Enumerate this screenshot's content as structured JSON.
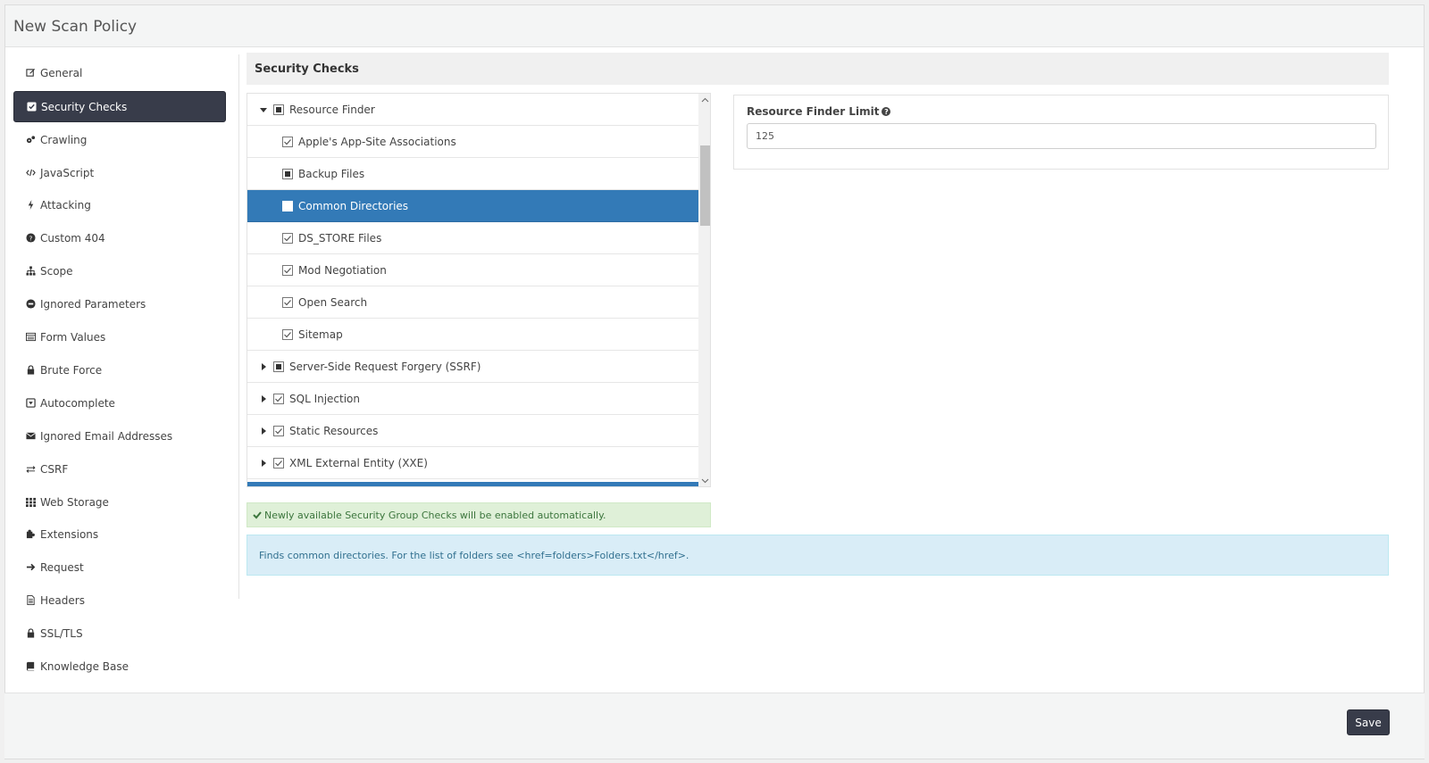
{
  "window": {
    "title": "New Scan Policy"
  },
  "sidebar": {
    "items": [
      {
        "label": "General",
        "icon": "edit-icon"
      },
      {
        "label": "Security Checks",
        "icon": "check-square-icon",
        "active": true
      },
      {
        "label": "Crawling",
        "icon": "gears-icon"
      },
      {
        "label": "JavaScript",
        "icon": "code-icon"
      },
      {
        "label": "Attacking",
        "icon": "bolt-icon"
      },
      {
        "label": "Custom 404",
        "icon": "question-circle-icon"
      },
      {
        "label": "Scope",
        "icon": "sitemap-icon"
      },
      {
        "label": "Ignored Parameters",
        "icon": "minus-circle-icon"
      },
      {
        "label": "Form Values",
        "icon": "form-icon"
      },
      {
        "label": "Brute Force",
        "icon": "lock-icon"
      },
      {
        "label": "Autocomplete",
        "icon": "caret-square-icon"
      },
      {
        "label": "Ignored Email Addresses",
        "icon": "envelope-icon"
      },
      {
        "label": "CSRF",
        "icon": "exchange-icon"
      },
      {
        "label": "Web Storage",
        "icon": "grid-icon"
      },
      {
        "label": "Extensions",
        "icon": "puzzle-icon"
      },
      {
        "label": "Request",
        "icon": "arrow-right-icon"
      },
      {
        "label": "Headers",
        "icon": "file-icon"
      },
      {
        "label": "SSL/TLS",
        "icon": "lock-icon"
      },
      {
        "label": "Knowledge Base",
        "icon": "book-icon"
      }
    ]
  },
  "main": {
    "section_title": "Security Checks",
    "tree": [
      {
        "label": "Resource Finder",
        "level": 0,
        "expander": "expanded",
        "state": "partial"
      },
      {
        "label": "Apple's App-Site Associations",
        "level": 1,
        "state": "checked"
      },
      {
        "label": "Backup Files",
        "level": 1,
        "state": "partial"
      },
      {
        "label": "Common Directories",
        "level": 1,
        "state": "unchecked",
        "selected": true
      },
      {
        "label": "DS_STORE Files",
        "level": 1,
        "state": "checked"
      },
      {
        "label": "Mod Negotiation",
        "level": 1,
        "state": "checked"
      },
      {
        "label": "Open Search",
        "level": 1,
        "state": "checked"
      },
      {
        "label": "Sitemap",
        "level": 1,
        "state": "checked"
      },
      {
        "label": "Server-Side Request Forgery (SSRF)",
        "level": 0,
        "expander": "collapsed",
        "state": "partial"
      },
      {
        "label": "SQL Injection",
        "level": 0,
        "expander": "collapsed",
        "state": "checked"
      },
      {
        "label": "Static Resources",
        "level": 0,
        "expander": "collapsed",
        "state": "checked"
      },
      {
        "label": "XML External Entity (XXE)",
        "level": 0,
        "expander": "collapsed",
        "state": "checked"
      }
    ],
    "settings": {
      "limit_label": "Resource Finder Limit",
      "limit_value": "125"
    },
    "success_message": "Newly available Security Group Checks will be enabled automatically.",
    "info_message": "Finds common directories. For the list of folders see <href=folders>Folders.txt</href>."
  },
  "footer": {
    "save_label": "Save"
  },
  "colors": {
    "active_nav": "#383c4a",
    "selected_row": "#337ab7",
    "success_bg": "#dff0d8",
    "info_bg": "#d9edf7"
  }
}
